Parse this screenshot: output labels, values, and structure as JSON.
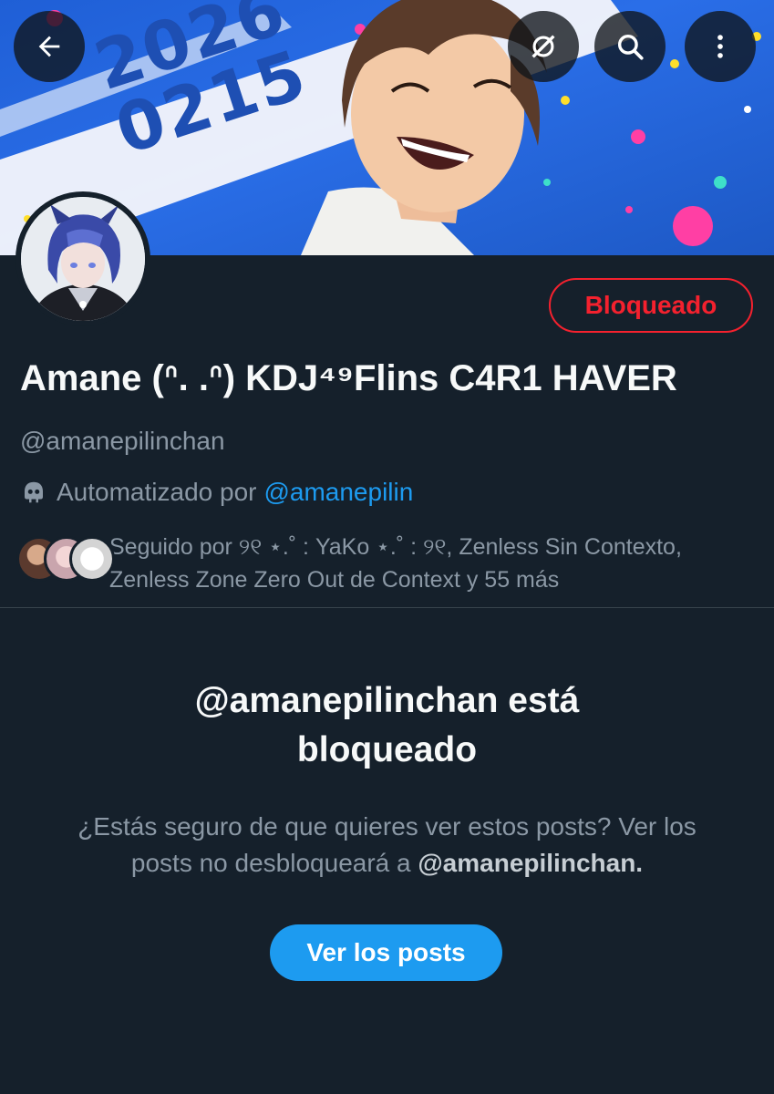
{
  "header": {
    "banner_date_line1": "2026",
    "banner_date_line2": "0215",
    "back_label": "Volver",
    "icons": [
      "back-arrow-icon",
      "grok-icon",
      "search-icon",
      "more-vertical-icon"
    ]
  },
  "profile": {
    "display_name": "Amane (ᐢ. .ᐢ) KDJ⁴⁹Flins C4R1 HAVER",
    "handle": "@amanepilinchan",
    "automated_prefix": "Automatizado por",
    "automated_by": "@amanepilin",
    "blocked_button": "Bloqueado",
    "followed_by": "Seguido por ୨୧ ⋆.˚ : YaKo ⋆.˚ : ୨୧, Zenless Sin Contexto, Zenless Zone Zero Out de Context y 55 más"
  },
  "notice": {
    "title": "@amanepilinchan está bloqueado",
    "text_before": "¿Estás seguro de que quieres ver estos posts? Ver los posts no desbloqueará a",
    "text_handle": "@amanepilinchan.",
    "button": "Ver los posts"
  },
  "colors": {
    "background": "#15202b",
    "accent": "#1d9bf0",
    "danger": "#f4212e",
    "secondary_text": "#8b98a5"
  }
}
